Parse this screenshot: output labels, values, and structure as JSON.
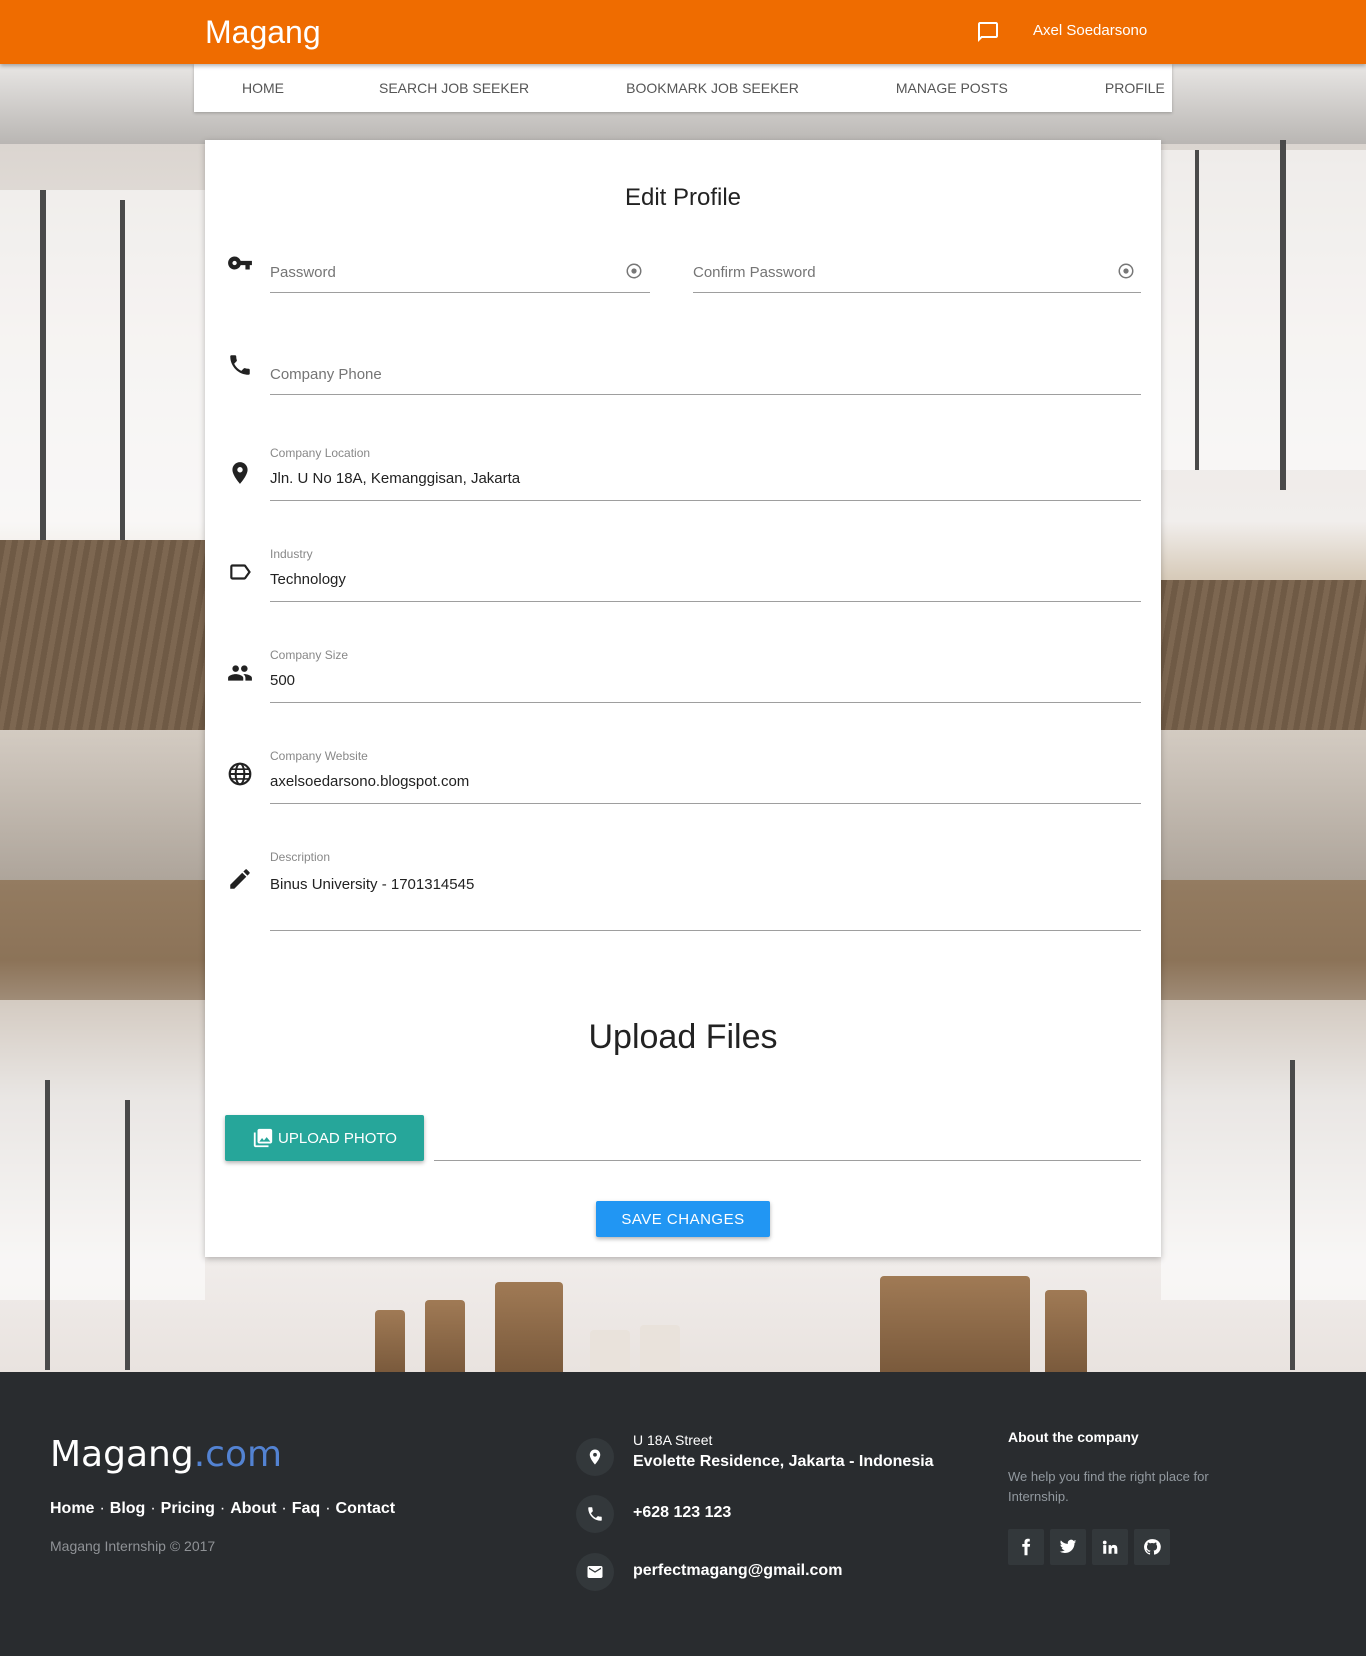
{
  "header": {
    "brand": "Magang",
    "user_name": "Axel Soedarsono"
  },
  "nav": {
    "tabs": [
      "HOME",
      "SEARCH JOB SEEKER",
      "BOOKMARK JOB SEEKER",
      "MANAGE POSTS",
      "PROFILE"
    ]
  },
  "form": {
    "title": "Edit Profile",
    "password": {
      "placeholder": "Password"
    },
    "confirm_password": {
      "placeholder": "Confirm Password"
    },
    "company_phone": {
      "placeholder": "Company Phone"
    },
    "company_location": {
      "label": "Company Location",
      "value": "Jln. U No 18A, Kemanggisan, Jakarta"
    },
    "industry": {
      "label": "Industry",
      "value": "Technology"
    },
    "company_size": {
      "label": "Company Size",
      "value": "500"
    },
    "company_website": {
      "label": "Company Website",
      "value": "axelsoedarsono.blogspot.com"
    },
    "description": {
      "label": "Description",
      "value": "Binus University - 1701314545"
    }
  },
  "upload": {
    "title": "Upload Files",
    "button_label": "UPLOAD PHOTO"
  },
  "actions": {
    "save_label": "SAVE CHANGES"
  },
  "footer": {
    "logo_main": "Magang",
    "logo_suffix": ".com",
    "links": [
      "Home",
      "Blog",
      "Pricing",
      "About",
      "Faq",
      "Contact"
    ],
    "link_separator": "·",
    "copyright": "Magang Internship © 2017",
    "address_line1": "U 18A Street",
    "address_line2": "Evolette Residence, Jakarta - Indonesia",
    "phone": "+628 123 123",
    "email": "perfectmagang@gmail.com",
    "about_title": "About the company",
    "about_text": "We help you find the right place for Internship."
  },
  "colors": {
    "topbar": "#ef6c00",
    "upload_button": "#26a69a",
    "save_button": "#2196f3",
    "footer_bg": "#292c2f",
    "logo_accent": "#5383d3"
  },
  "icons": [
    "chat-icon",
    "key-icon",
    "eye-icon",
    "phone-icon",
    "location-pin-icon",
    "tag-icon",
    "people-icon",
    "globe-icon",
    "pencil-icon",
    "photo-library-icon",
    "facebook-icon",
    "twitter-icon",
    "linkedin-icon",
    "github-icon",
    "envelope-icon"
  ]
}
